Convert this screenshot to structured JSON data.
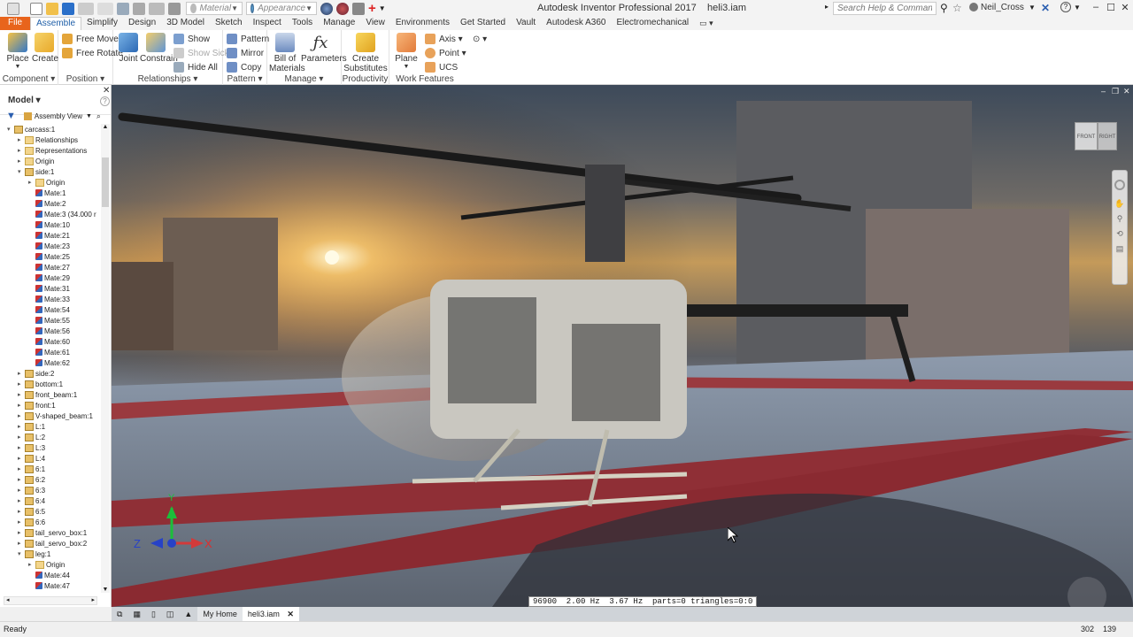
{
  "app": {
    "title": "Autodesk Inventor Professional 2017",
    "document": "heli3.iam",
    "search_placeholder": "Search Help & Commands...",
    "user": "Neil_Cross"
  },
  "quick_access": {
    "material_value": "Material",
    "appearance_value": "Appearance"
  },
  "tabs": [
    "File",
    "Assemble",
    "Simplify",
    "Design",
    "3D Model",
    "Sketch",
    "Inspect",
    "Tools",
    "Manage",
    "View",
    "Environments",
    "Get Started",
    "Vault",
    "Autodesk A360",
    "Electromechanical"
  ],
  "active_tab": "Assemble",
  "ribbon": {
    "component": {
      "label": "Component",
      "place": "Place",
      "create": "Create"
    },
    "position": {
      "label": "Position",
      "free_move": "Free Move",
      "free_rotate": "Free Rotate"
    },
    "relationships": {
      "label": "Relationships",
      "joint": "Joint",
      "constrain": "Constrain",
      "show": "Show",
      "show_sick": "Show Sick",
      "hide_all": "Hide All"
    },
    "pattern": {
      "label": "Pattern",
      "pattern": "Pattern",
      "mirror": "Mirror",
      "copy": "Copy"
    },
    "manage": {
      "label": "Manage",
      "bom1": "Bill of",
      "bom2": "Materials",
      "parameters": "Parameters"
    },
    "productivity": {
      "label": "Productivity",
      "cs1": "Create",
      "cs2": "Substitutes"
    },
    "work_features": {
      "label": "Work Features",
      "plane": "Plane",
      "axis": "Axis",
      "point": "Point",
      "ucs": "UCS"
    }
  },
  "browser": {
    "title": "Model",
    "view_mode": "Assembly View",
    "tree": [
      {
        "d": 0,
        "tw": "▾",
        "ic": "part",
        "label": "carcass:1"
      },
      {
        "d": 1,
        "tw": "▸",
        "ic": "folder",
        "label": "Relationships"
      },
      {
        "d": 1,
        "tw": "▸",
        "ic": "folder",
        "label": "Representations"
      },
      {
        "d": 1,
        "tw": "▸",
        "ic": "folder",
        "label": "Origin"
      },
      {
        "d": 1,
        "tw": "▾",
        "ic": "part",
        "label": "side:1"
      },
      {
        "d": 2,
        "tw": "▸",
        "ic": "folder",
        "label": "Origin"
      },
      {
        "d": 2,
        "tw": "",
        "ic": "mate",
        "label": "Mate:1"
      },
      {
        "d": 2,
        "tw": "",
        "ic": "mate",
        "label": "Mate:2"
      },
      {
        "d": 2,
        "tw": "",
        "ic": "mate",
        "label": "Mate:3 (34.000 r"
      },
      {
        "d": 2,
        "tw": "",
        "ic": "mate",
        "label": "Mate:10"
      },
      {
        "d": 2,
        "tw": "",
        "ic": "mate",
        "label": "Mate:21"
      },
      {
        "d": 2,
        "tw": "",
        "ic": "mate",
        "label": "Mate:23"
      },
      {
        "d": 2,
        "tw": "",
        "ic": "mate",
        "label": "Mate:25"
      },
      {
        "d": 2,
        "tw": "",
        "ic": "mate",
        "label": "Mate:27"
      },
      {
        "d": 2,
        "tw": "",
        "ic": "mate",
        "label": "Mate:29"
      },
      {
        "d": 2,
        "tw": "",
        "ic": "mate",
        "label": "Mate:31"
      },
      {
        "d": 2,
        "tw": "",
        "ic": "mate",
        "label": "Mate:33"
      },
      {
        "d": 2,
        "tw": "",
        "ic": "mate",
        "label": "Mate:54"
      },
      {
        "d": 2,
        "tw": "",
        "ic": "mate",
        "label": "Mate:55"
      },
      {
        "d": 2,
        "tw": "",
        "ic": "mate",
        "label": "Mate:56"
      },
      {
        "d": 2,
        "tw": "",
        "ic": "mate",
        "label": "Mate:60"
      },
      {
        "d": 2,
        "tw": "",
        "ic": "mate",
        "label": "Mate:61"
      },
      {
        "d": 2,
        "tw": "",
        "ic": "mate",
        "label": "Mate:62"
      },
      {
        "d": 1,
        "tw": "▸",
        "ic": "part",
        "label": "side:2"
      },
      {
        "d": 1,
        "tw": "▸",
        "ic": "part",
        "label": "bottom:1"
      },
      {
        "d": 1,
        "tw": "▸",
        "ic": "part",
        "label": "front_beam:1"
      },
      {
        "d": 1,
        "tw": "▸",
        "ic": "part",
        "label": "front:1"
      },
      {
        "d": 1,
        "tw": "▸",
        "ic": "part",
        "label": "V-shaped_beam:1"
      },
      {
        "d": 1,
        "tw": "▸",
        "ic": "part",
        "label": "L:1"
      },
      {
        "d": 1,
        "tw": "▸",
        "ic": "part",
        "label": "L:2"
      },
      {
        "d": 1,
        "tw": "▸",
        "ic": "part",
        "label": "L:3"
      },
      {
        "d": 1,
        "tw": "▸",
        "ic": "part",
        "label": "L:4"
      },
      {
        "d": 1,
        "tw": "▸",
        "ic": "part",
        "label": "6:1"
      },
      {
        "d": 1,
        "tw": "▸",
        "ic": "part",
        "label": "6:2"
      },
      {
        "d": 1,
        "tw": "▸",
        "ic": "part",
        "label": "6:3"
      },
      {
        "d": 1,
        "tw": "▸",
        "ic": "part",
        "label": "6:4"
      },
      {
        "d": 1,
        "tw": "▸",
        "ic": "part",
        "label": "6:5"
      },
      {
        "d": 1,
        "tw": "▸",
        "ic": "part",
        "label": "6:6"
      },
      {
        "d": 1,
        "tw": "▸",
        "ic": "part",
        "label": "tail_servo_box:1"
      },
      {
        "d": 1,
        "tw": "▸",
        "ic": "part",
        "label": "tail_servo_box:2"
      },
      {
        "d": 1,
        "tw": "▾",
        "ic": "part",
        "label": "leg:1"
      },
      {
        "d": 2,
        "tw": "▸",
        "ic": "folder",
        "label": "Origin"
      },
      {
        "d": 2,
        "tw": "",
        "ic": "mate",
        "label": "Mate:44"
      },
      {
        "d": 2,
        "tw": "",
        "ic": "mate",
        "label": "Mate:47"
      }
    ]
  },
  "viewcube": {
    "front": "FRONT",
    "right": "RIGHT"
  },
  "axes": {
    "x": "X",
    "y": "Y",
    "z": "Z"
  },
  "viewport_status": "96900  2.00 Hz  3.67 Hz  parts=0 triangles=0:0",
  "doc_tabs": {
    "home": "My Home",
    "active": "heli3.iam"
  },
  "statusbar": {
    "text": "Ready",
    "count1": "302",
    "count2": "139"
  }
}
